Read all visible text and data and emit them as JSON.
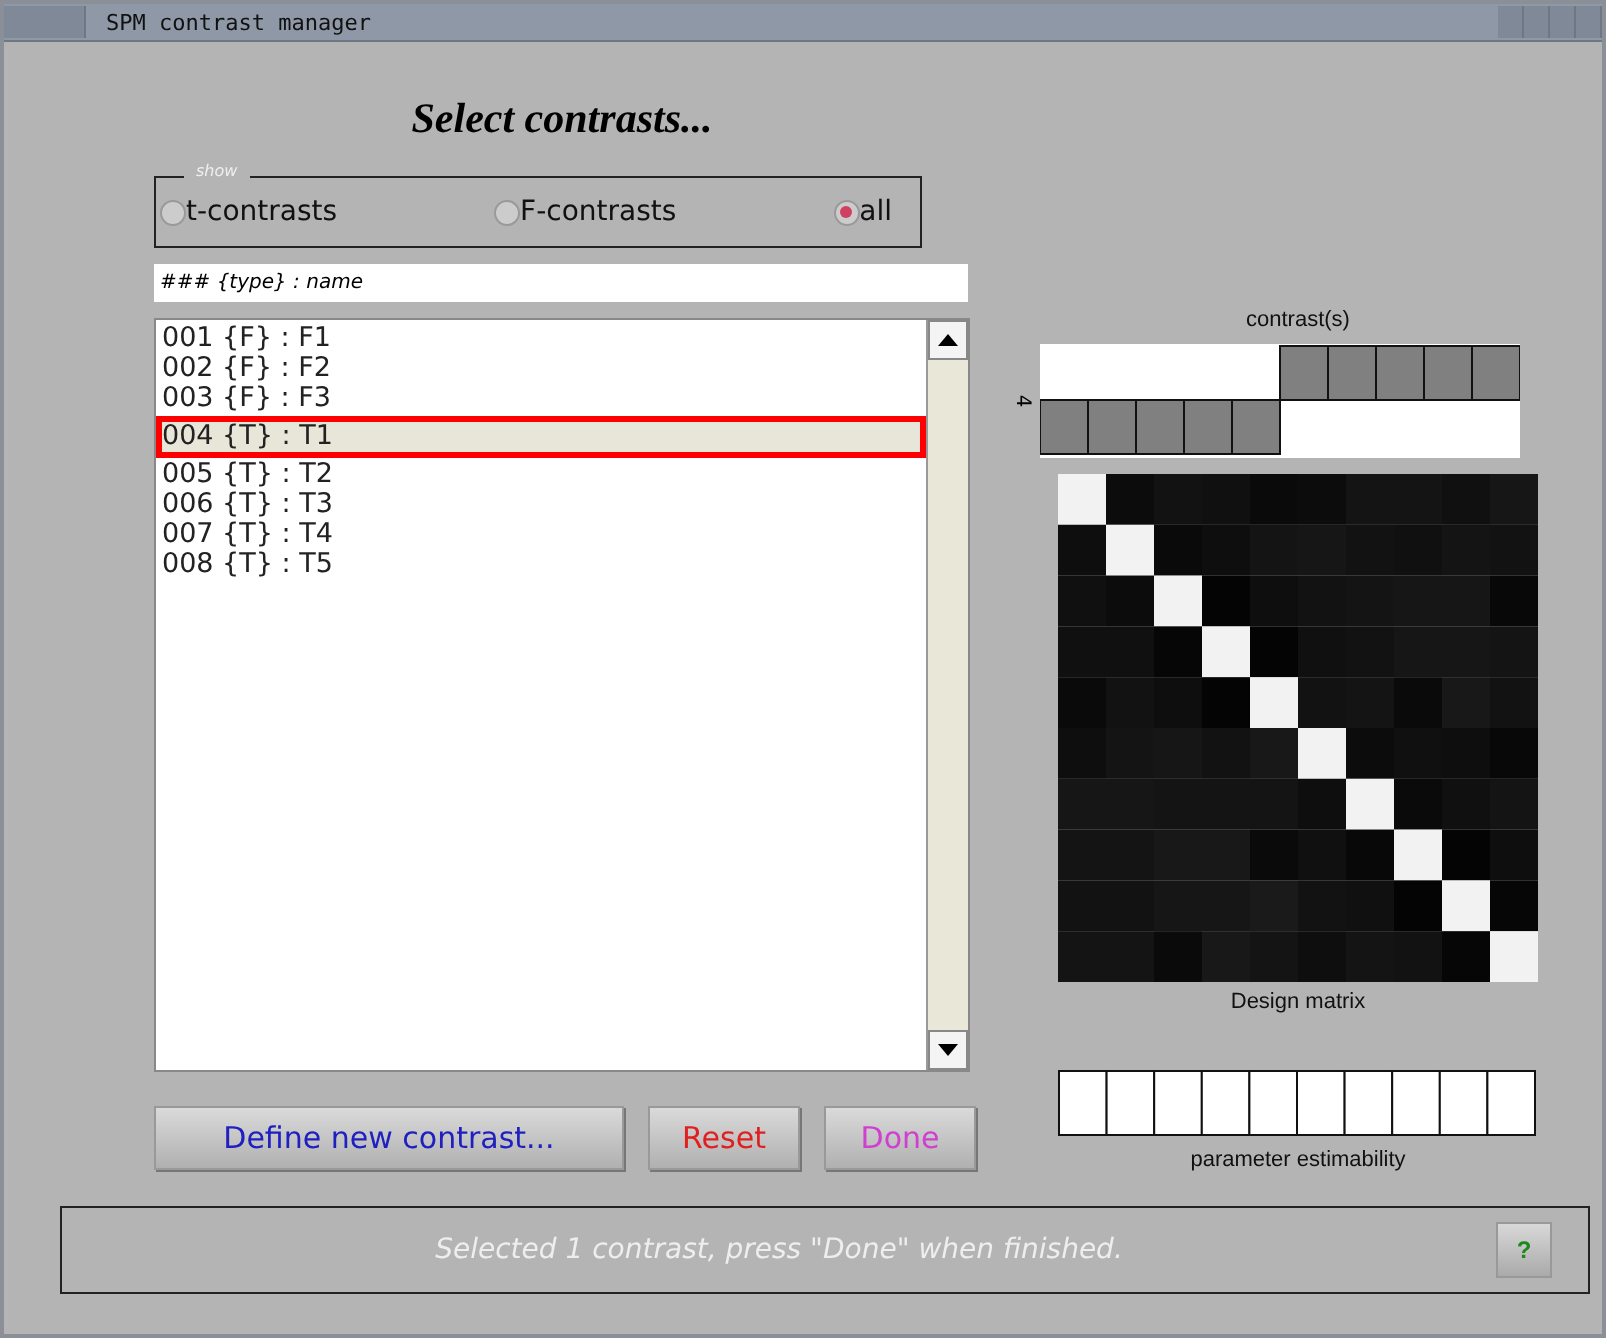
{
  "window": {
    "title": "SPM contrast manager"
  },
  "heading": "Select contrasts...",
  "show_group": {
    "legend": "show",
    "options": [
      {
        "label": "t-contrasts",
        "selected": false
      },
      {
        "label": "F-contrasts",
        "selected": false
      },
      {
        "label": "all",
        "selected": true
      }
    ]
  },
  "list_header": "### {type} : name",
  "contrasts": [
    {
      "label": "001 {F} : F1",
      "selected": false
    },
    {
      "label": "002 {F} : F2",
      "selected": false
    },
    {
      "label": "003 {F} : F3",
      "selected": false
    },
    {
      "label": "004 {T} : T1",
      "selected": true
    },
    {
      "label": "005 {T} : T2",
      "selected": false
    },
    {
      "label": "006 {T} : T3",
      "selected": false
    },
    {
      "label": "007 {T} : T4",
      "selected": false
    },
    {
      "label": "008 {T} : T5",
      "selected": false
    }
  ],
  "buttons": [
    {
      "label": "Define new contrast...",
      "color": "#2020c0"
    },
    {
      "label": "Reset",
      "color": "#e02020"
    },
    {
      "label": "Done",
      "color": "#d040d0"
    }
  ],
  "contrast_panel": {
    "title": "contrast(s)",
    "axis_label": "4"
  },
  "design_matrix": {
    "label": "Design matrix"
  },
  "estimability": {
    "label": "parameter estimability"
  },
  "status": "Selected 1 contrast, press \"Done\" when finished.",
  "help_button": "?"
}
